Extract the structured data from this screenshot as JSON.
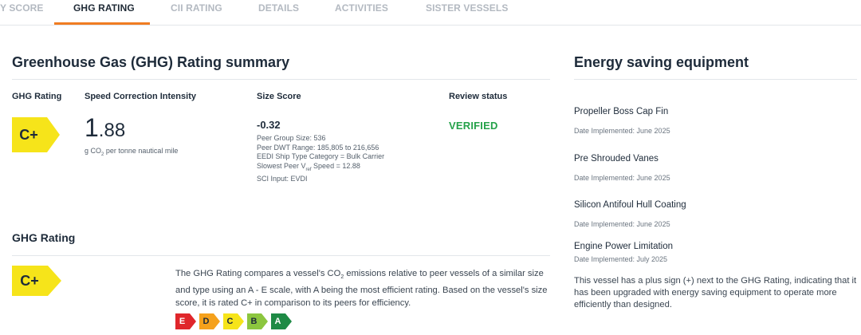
{
  "tabs": [
    {
      "label": "Y SCORE",
      "active": false
    },
    {
      "label": "GHG RATING",
      "active": true
    },
    {
      "label": "CII RATING",
      "active": false
    },
    {
      "label": "DETAILS",
      "active": false
    },
    {
      "label": "ACTIVITIES",
      "active": false
    },
    {
      "label": "SISTER VESSELS",
      "active": false
    }
  ],
  "summary": {
    "title": "Greenhouse Gas (GHG) Rating summary",
    "col_rating": "GHG Rating",
    "col_sci": "Speed Correction Intensity",
    "col_size": "Size Score",
    "col_review": "Review status",
    "rating": "C+",
    "sci_int": "1",
    "sci_dec": ".88",
    "sci_unit_a": "g CO",
    "sci_unit_sub": "2",
    "sci_unit_b": " per tonne nautical mile",
    "size_score": "-0.32",
    "peer_group": "Peer Group Size: 536",
    "peer_dwt": "Peer DWT Range: 185,805 to 216,656",
    "eedi": "EEDI Ship Type Category = Bulk Carrier",
    "slowest_a": "Slowest Peer V",
    "slowest_sub": "ref",
    "slowest_b": " Speed = 12.88",
    "sci_input": "SCI Input: EVDI",
    "review_status": "VERIFIED"
  },
  "ghg_section": {
    "title": "GHG Rating",
    "rating": "C+",
    "desc_a": "The GHG Rating compares a vessel's CO",
    "desc_sub": "2",
    "desc_b": " emissions relative to peer vessels of a similar size and type using an A - E scale, with A being the most efficient rating. Based on the vessel's size score, it is rated C+ in comparison to its peers for efficiency.",
    "scale": [
      {
        "letter": "E",
        "color": "#e0262b",
        "text_color": "#ffffff"
      },
      {
        "letter": "D",
        "color": "#f5a11c",
        "text_color": "#1e2b3a"
      },
      {
        "letter": "C",
        "color": "#f6e41a",
        "text_color": "#1e2b3a"
      },
      {
        "letter": "B",
        "color": "#8cc63f",
        "text_color": "#1e2b3a"
      },
      {
        "letter": "A",
        "color": "#1e8a45",
        "text_color": "#ffffff"
      }
    ]
  },
  "equipment": {
    "title": "Energy saving equipment",
    "items": [
      {
        "name": "Propeller Boss Cap Fin",
        "date": "Date Implemented: June 2025"
      },
      {
        "name": "Pre Shrouded Vanes",
        "date": "Date Implemented: June 2025"
      },
      {
        "name": "Silicon Antifoul Hull Coating",
        "date": "Date Implemented: June 2025"
      },
      {
        "name": "Engine Power Limitation",
        "date": "Date Implemented: July 2025"
      }
    ],
    "note": "This vessel has a plus sign (+) next to the GHG Rating, indicating that it has been upgraded with energy saving equipment to operate more efficiently than designed."
  },
  "colors": {
    "accent": "#f07c22",
    "badge_yellow": "#f6e41a",
    "verified_green": "#25a24a"
  }
}
